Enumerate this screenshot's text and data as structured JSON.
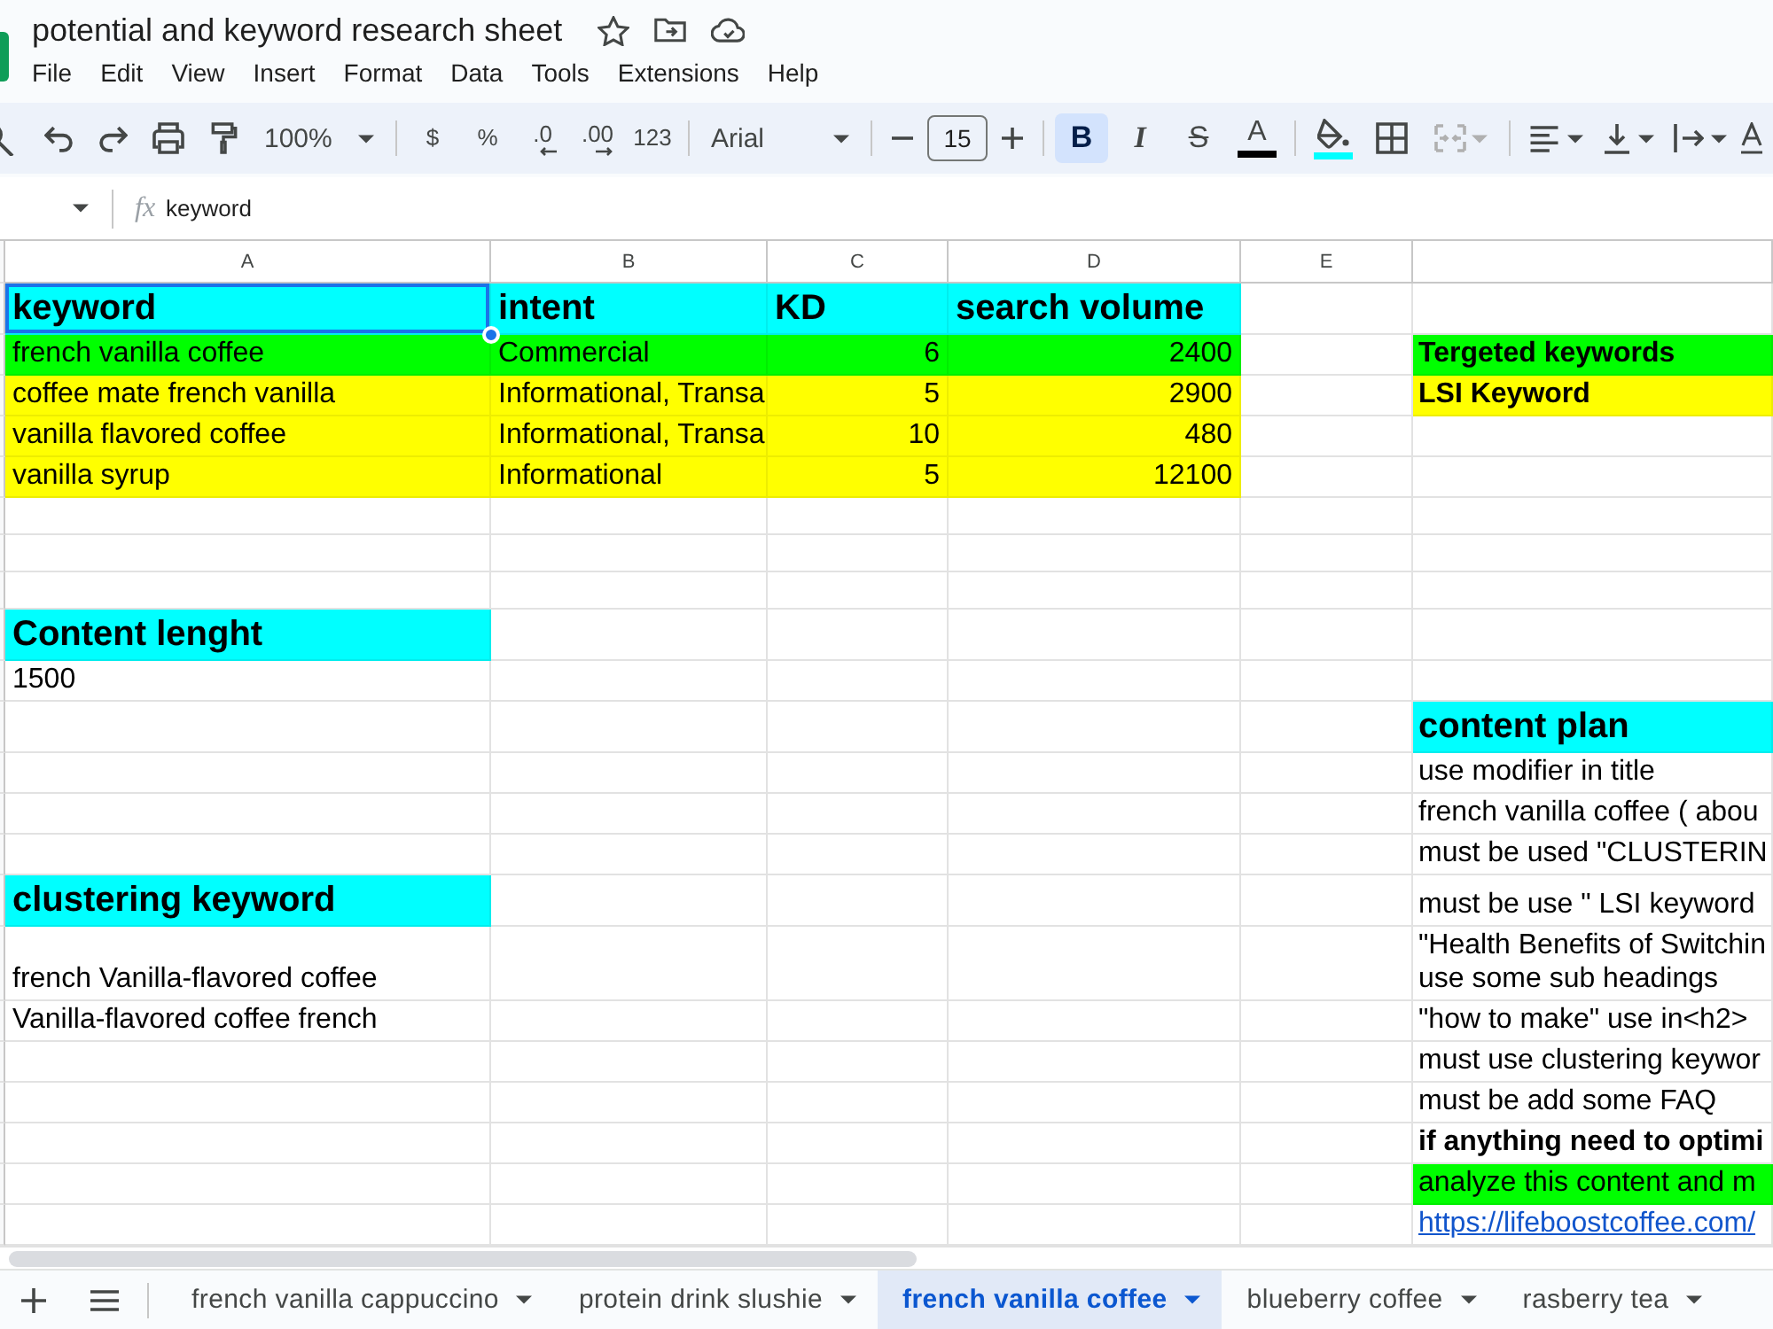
{
  "window": {
    "title": "potential and keyword research sheet"
  },
  "menu": [
    "File",
    "Edit",
    "View",
    "Insert",
    "Format",
    "Data",
    "Tools",
    "Extensions",
    "Help"
  ],
  "toolbar": {
    "zoom": "100%",
    "number_formats": [
      {
        "label": "$",
        "kind": "plain"
      },
      {
        "label": "%",
        "kind": "plain"
      },
      {
        "label": ".0",
        "kind": "decrease"
      },
      {
        "label": ".00",
        "kind": "increase"
      },
      {
        "label": "123",
        "kind": "plain"
      }
    ],
    "font": "Arial",
    "font_size": "15",
    "bold": {
      "label": "B",
      "on": true
    },
    "italic": {
      "label": "I",
      "on": false
    },
    "strikethrough": {
      "label": "S",
      "on": false
    },
    "text_color": {
      "label": "A",
      "color": "#000000"
    },
    "fill": {
      "color": "#00ffff"
    },
    "merge": {
      "disabled": true
    }
  },
  "formula_bar": {
    "label": "fx",
    "content": "keyword"
  },
  "grid": {
    "columns": [
      "A",
      "B",
      "C",
      "D",
      "E"
    ],
    "rows": [
      [
        {
          "text": "keyword",
          "kind": "heading",
          "bold": true,
          "selected": true,
          "color": "#00ffff"
        },
        {
          "text": "intent",
          "kind": "heading",
          "bold": true,
          "selected": false,
          "color": "#00ffff"
        },
        {
          "text": "KD",
          "kind": "heading",
          "bold": true,
          "selected": false,
          "color": "#00ffff"
        },
        {
          "text": "search volume",
          "kind": "heading",
          "bold": true,
          "selected": false,
          "color": "#00ffff"
        },
        null,
        null
      ],
      [
        {
          "text": "french vanilla coffee",
          "kind": "text",
          "bold": false,
          "selected": false,
          "color": "#00ff00"
        },
        {
          "text": "Commercial",
          "kind": "text",
          "bold": false,
          "selected": false,
          "color": "#00ff00"
        },
        {
          "text": "6",
          "kind": "number",
          "bold": false,
          "selected": false,
          "color": "#00ff00"
        },
        {
          "text": "2400",
          "kind": "number",
          "bold": false,
          "selected": false,
          "color": "#00ff00"
        },
        null,
        {
          "text": "Tergeted keywords",
          "kind": "text",
          "bold": true,
          "selected": false,
          "color": "#00ff00"
        }
      ],
      [
        {
          "text": "coffee mate french vanilla",
          "kind": "text",
          "bold": false,
          "selected": false,
          "color": "#ffff00"
        },
        {
          "text": "Informational, Transa",
          "kind": "text",
          "bold": false,
          "selected": false,
          "color": "#ffff00"
        },
        {
          "text": "5",
          "kind": "number",
          "bold": false,
          "selected": false,
          "color": "#ffff00"
        },
        {
          "text": "2900",
          "kind": "number",
          "bold": false,
          "selected": false,
          "color": "#ffff00"
        },
        null,
        {
          "text": "LSI Keyword",
          "kind": "text",
          "bold": true,
          "selected": false,
          "color": "#ffff00"
        }
      ],
      [
        {
          "text": "vanilla flavored coffee",
          "kind": "text",
          "bold": false,
          "selected": false,
          "color": "#ffff00"
        },
        {
          "text": "Informational, Transa",
          "kind": "text",
          "bold": false,
          "selected": false,
          "color": "#ffff00"
        },
        {
          "text": "10",
          "kind": "number",
          "bold": false,
          "selected": false,
          "color": "#ffff00"
        },
        {
          "text": "480",
          "kind": "number",
          "bold": false,
          "selected": false,
          "color": "#ffff00"
        },
        null,
        null
      ],
      [
        {
          "text": "vanilla syrup",
          "kind": "text",
          "bold": false,
          "selected": false,
          "color": "#ffff00"
        },
        {
          "text": "Informational",
          "kind": "text",
          "bold": false,
          "selected": false,
          "color": "#ffff00"
        },
        {
          "text": "5",
          "kind": "number",
          "bold": false,
          "selected": false,
          "color": "#ffff00"
        },
        {
          "text": "12100",
          "kind": "number",
          "bold": false,
          "selected": false,
          "color": "#ffff00"
        },
        null,
        null
      ],
      [
        null,
        null,
        null,
        null,
        null,
        null
      ],
      [
        null,
        null,
        null,
        null,
        null,
        null
      ],
      [
        null,
        null,
        null,
        null,
        null,
        null
      ],
      [
        {
          "text": "Content lenght",
          "kind": "heading",
          "bold": true,
          "selected": false,
          "color": "#00ffff"
        },
        null,
        null,
        null,
        null,
        null
      ],
      [
        {
          "text": "1500",
          "kind": "text",
          "bold": false,
          "selected": false
        },
        null,
        null,
        null,
        null,
        null
      ],
      [
        null,
        null,
        null,
        null,
        null,
        {
          "text": "content plan",
          "kind": "heading",
          "bold": true,
          "selected": false,
          "color": "#00ffff"
        }
      ],
      [
        null,
        null,
        null,
        null,
        null,
        {
          "text": "use modifier in title",
          "kind": "text",
          "bold": false,
          "selected": false
        }
      ],
      [
        null,
        null,
        null,
        null,
        null,
        {
          "text": "french vanilla coffee ( abou",
          "kind": "text",
          "bold": false,
          "selected": false
        }
      ],
      [
        null,
        null,
        null,
        null,
        null,
        {
          "text": "must be used \"CLUSTERIN",
          "kind": "text",
          "bold": false,
          "selected": false
        }
      ],
      [
        {
          "text": "clustering keyword",
          "kind": "heading",
          "bold": true,
          "selected": false,
          "color": "#00ffff"
        },
        null,
        null,
        null,
        null,
        {
          "text": "must be use \" LSI keyword",
          "kind": "text",
          "bold": false,
          "selected": false
        }
      ],
      [
        {
          "text": "french Vanilla-flavored coffee",
          "kind": "text",
          "bold": false,
          "selected": false
        },
        null,
        null,
        null,
        null,
        {
          "text": "\"Health Benefits of Switchin\nuse some sub headings",
          "kind": "text",
          "bold": false,
          "selected": false
        }
      ],
      [
        {
          "text": "Vanilla-flavored coffee french",
          "kind": "text",
          "bold": false,
          "selected": false
        },
        null,
        null,
        null,
        null,
        {
          "text": "\"how to make\" use in<h2>",
          "kind": "text",
          "bold": false,
          "selected": false
        }
      ],
      [
        null,
        null,
        null,
        null,
        null,
        {
          "text": "must use clustering keywor",
          "kind": "text",
          "bold": false,
          "selected": false
        }
      ],
      [
        null,
        null,
        null,
        null,
        null,
        {
          "text": "must be add some FAQ",
          "kind": "text",
          "bold": false,
          "selected": false
        }
      ],
      [
        null,
        null,
        null,
        null,
        null,
        {
          "text": "if anything need to optimi",
          "kind": "text",
          "bold": true,
          "selected": false
        }
      ],
      [
        null,
        null,
        null,
        null,
        null,
        {
          "text": "analyze this content and m",
          "kind": "text",
          "bold": false,
          "selected": false,
          "color": "#00ff00"
        }
      ],
      [
        null,
        null,
        null,
        null,
        null,
        {
          "text": "https://lifeboostcoffee.com/",
          "kind": "link",
          "bold": false,
          "selected": false
        }
      ]
    ]
  },
  "sheet_tabs": [
    {
      "label": "french vanilla cappuccino",
      "selected": false
    },
    {
      "label": "protein drink slushie",
      "selected": false
    },
    {
      "label": "french vanilla coffee",
      "selected": true
    },
    {
      "label": "blueberry coffee",
      "selected": false
    },
    {
      "label": "rasberry tea",
      "selected": false
    }
  ]
}
